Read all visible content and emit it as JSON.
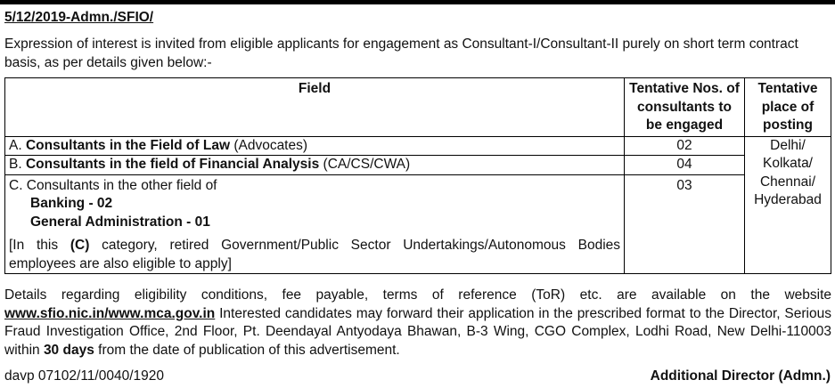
{
  "reference": "5/12/2019-Admn./SFIO/",
  "intro": "Expression of interest is invited from eligible applicants for engagement as Consultant-I/Consultant-II purely on short term contract basis, as per details given below:-",
  "table": {
    "headers": {
      "field": "Field",
      "nos": "Tentative Nos. of consultants to be engaged",
      "place": "Tentative place of posting"
    },
    "rows": [
      {
        "prefix": "A. ",
        "bold": "Consultants in the Field of Law",
        "rest": " (Advocates)",
        "nos": "02"
      },
      {
        "prefix": "B. ",
        "bold": "Consultants in the field of Financial Analysis",
        "rest": " (CA/CS/CWA)",
        "nos": "04"
      }
    ],
    "row_c": {
      "text": "C. Consultants in the other field of",
      "sub1": "Banking - 02",
      "sub2": "General Administration - 01",
      "note_pre": "[In this ",
      "note_bold": "(C)",
      "note_post": " category, retired Government/Public Sector Undertakings/Autonomous Bodies employees are also eligible to apply]",
      "nos": "03"
    },
    "place": [
      "Delhi/",
      "Kolkata/",
      "Chennai/",
      "Hyderabad"
    ]
  },
  "details": {
    "part1": "Details regarding eligibility conditions, fee payable, terms of reference (ToR) etc. are available on the website ",
    "link": "www.sfio.nic.in/www.mca.gov.in",
    "part2": " Interested candidates may forward their application in the prescribed format to the Director, Serious Fraud Investigation Office, 2nd Floor, Pt. Deendayal Antyodaya Bhawan, B-3 Wing, CGO Complex, Lodhi Road, New Delhi-110003 within ",
    "bold": "30 days",
    "part3": " from the date of publication of this advertisement."
  },
  "footer": {
    "davp": "davp 07102/11/0040/1920",
    "signatory": "Additional Director (Admn.)"
  }
}
